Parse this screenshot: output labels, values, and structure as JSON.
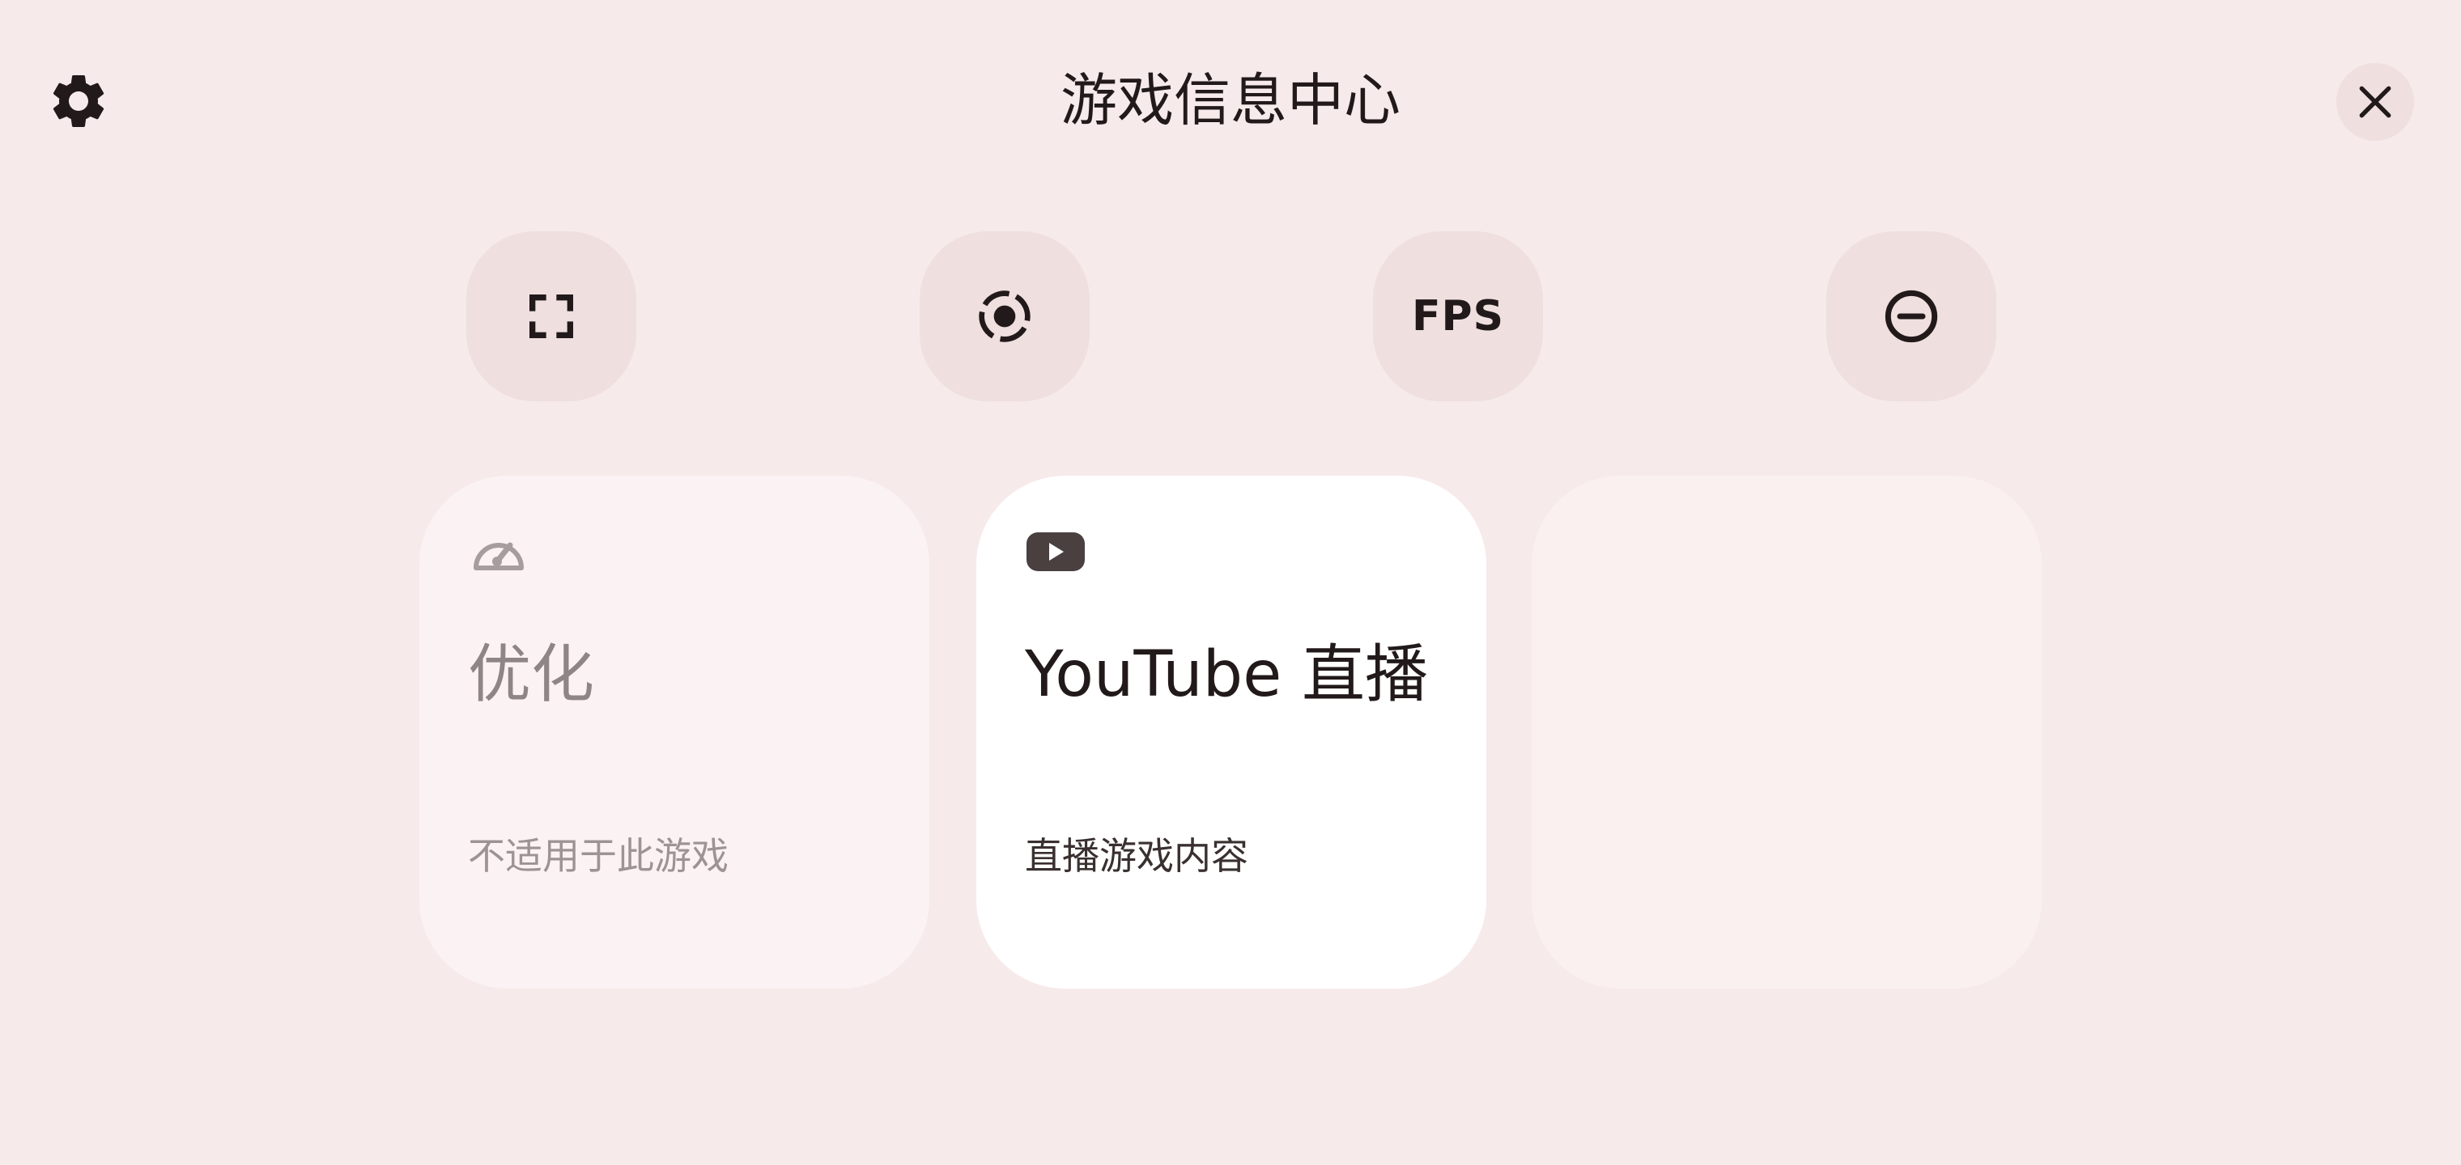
{
  "header": {
    "title": "游戏信息中心",
    "settings_icon": "gear-icon",
    "close_icon": "close-icon"
  },
  "quick_tiles": [
    {
      "id": "screenshot",
      "icon": "screenshot-frame-icon"
    },
    {
      "id": "record",
      "icon": "screen-record-icon"
    },
    {
      "id": "fps",
      "icon": "fps-text-icon",
      "label": "FPS"
    },
    {
      "id": "dnd",
      "icon": "do-not-disturb-icon"
    }
  ],
  "cards": [
    {
      "id": "optimize",
      "icon": "speedometer-icon",
      "title": "优化",
      "subtitle": "不适用于此游戏",
      "enabled": false
    },
    {
      "id": "youtube",
      "icon": "youtube-icon",
      "title": "YouTube 直播",
      "subtitle": "直播游戏内容",
      "enabled": true
    },
    {
      "id": "empty",
      "enabled": false
    }
  ],
  "colors": {
    "background": "#f7eaea",
    "tile": "#efdfdf",
    "card_active": "#ffffff",
    "card_disabled": "#fbf3f3",
    "text_primary": "#221a1a",
    "text_disabled": "#8f8585"
  }
}
